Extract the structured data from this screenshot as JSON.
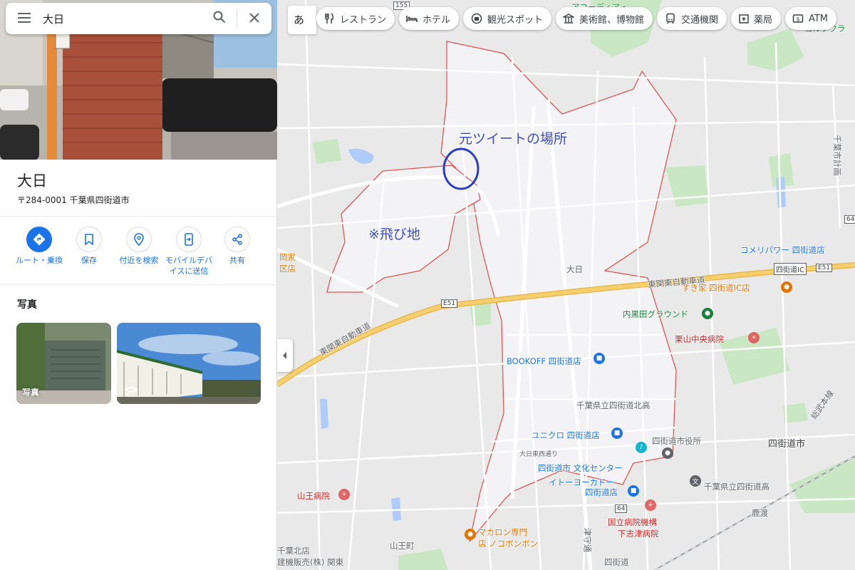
{
  "search": {
    "query": "大日"
  },
  "place": {
    "title": "大日",
    "address": "〒284-0001 千葉県四街道市"
  },
  "actions": [
    {
      "label": "ルート・乗換",
      "icon": "directions-icon"
    },
    {
      "label": "保存",
      "icon": "bookmark-icon"
    },
    {
      "label": "付近を検索",
      "icon": "nearby-icon"
    },
    {
      "label": "モバイルデバ",
      "label2": "イスに送信",
      "icon": "send-to-phone-icon"
    },
    {
      "label": "共有",
      "icon": "share-icon"
    }
  ],
  "photos": {
    "title": "写真",
    "first_caption": "写真"
  },
  "ime": "あ",
  "chips": [
    {
      "label": "レストラン",
      "icon": "restaurant-icon"
    },
    {
      "label": "ホテル",
      "icon": "hotel-icon"
    },
    {
      "label": "観光スポット",
      "icon": "attraction-icon"
    },
    {
      "label": "美術館、博物館",
      "icon": "museum-icon"
    },
    {
      "label": "交通機関",
      "icon": "transit-icon"
    },
    {
      "label": "薬局",
      "icon": "pharmacy-icon"
    },
    {
      "label": "ATM",
      "icon": "atm-icon"
    }
  ],
  "annotations": {
    "tweet_place": "元ツイートの場所",
    "enclave": "※飛び地"
  },
  "map_labels": {
    "area": "大日",
    "expressway": "東関東自動車道",
    "expressway2": "東関東自動車道",
    "e51": "E51",
    "e51b": "E51",
    "ic": "四街道IC",
    "r155": "155",
    "r64": "64",
    "r64b": "64",
    "komeri": "コメリパワー 四街道店",
    "sukiya": "すき家 四街道IC店",
    "uchikuroda": "内黒田グラウンド",
    "kuriyama": "栗山中央病院",
    "bookoff": "BOOKOFF 四街道店",
    "hs_north": "千葉県立四街道北高",
    "uniqlo": "ユニクロ 四街道店",
    "city_office": "四街道市役所",
    "city": "四街道市",
    "ohi_east": "大日東西通り",
    "culture": "四街道市 文化センター",
    "ito": "イトーヨーカドー",
    "ito2": "四街道店",
    "hs": "千葉県立四街道高",
    "sanno_hosp": "山王病院",
    "macaron": "マカロン専門",
    "macaron2": "店 ノコボンボン",
    "national": "国立病院機構",
    "national2": "下志津病院",
    "sanno": "山王町",
    "kanoura": "鹿渡",
    "station": "四街道",
    "tsuzumi": "津守通",
    "chibakita": "千葉北店",
    "kanto": "建機販売(株) 関東",
    "accordia": "アコーディア・",
    "golf": "ゴルフクラ",
    "sobu": "総武本線",
    "chiba_line": "千葉市計画",
    "left_a": "岡家",
    "left_b": "区店"
  },
  "colors": {
    "accent": "#1a73e8",
    "boundary": "#e05555",
    "annot": "#3b4ac9",
    "expressway": "#f2c35a"
  }
}
